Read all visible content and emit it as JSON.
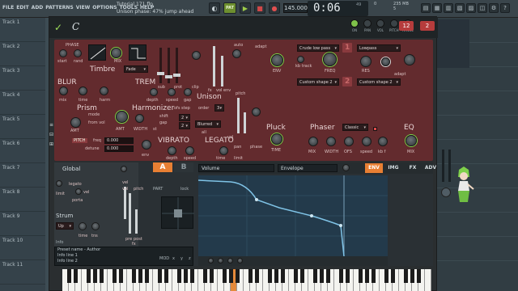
{
  "menu": [
    "FILE",
    "EDIT",
    "ADD",
    "PATTERNS",
    "VIEW",
    "OPTIONS",
    "TOOLS",
    "HELP"
  ],
  "song_title": "Tutorial 171.flp",
  "hint": "Unison phase: 47% jump ahead",
  "transport": {
    "pat_label": "PAT",
    "play": "▶",
    "stop": "■",
    "rec": "●",
    "tempo": "145.000"
  },
  "time": {
    "value": "0:06",
    "frames": "49",
    "sub": "M:S:CS"
  },
  "cpu": "0",
  "memory": {
    "top": "235 MB",
    "bottom": "5"
  },
  "playlist": {
    "tracks": [
      "Track 1",
      "Track 2",
      "Track 3",
      "Track 4",
      "Track 5",
      "Track 6",
      "Track 7",
      "Track 8",
      "Track 9",
      "Track 10",
      "Track 11"
    ]
  },
  "harmor": {
    "header": {
      "logo": "✓",
      "c_label": "C",
      "minis": [
        "ON",
        "PAN",
        "VOL",
        "PITCH",
        "RANGE"
      ],
      "num1": "12",
      "num2": "2"
    },
    "panel": {
      "phase": "PHASE",
      "start": "start",
      "rand": "rand",
      "mix": "MIX",
      "timbre": "Timbre",
      "fade": "Fade",
      "sub": "sub",
      "prot": "prot",
      "clip": "clip",
      "auto": "auto",
      "fx": "fx",
      "vol_env": "vol env",
      "adapt": "adapt",
      "filter1_type": "Crude low pass",
      "filter2_type": "Lowpass",
      "env": "ENV",
      "kb_track": "kb track",
      "freq": "FREQ",
      "res": "RES",
      "adapt2": "adapt",
      "shape1": "Custom shape 2",
      "shape2": "Custom shape 2",
      "blur": "BLUR",
      "mix2": "mix",
      "time": "time",
      "harm": "harm",
      "trem": "TREM",
      "depth": "depth",
      "speed": "speed",
      "gap": "gap",
      "unison": "Unison",
      "order": "order",
      "order_val": "3",
      "pitch": "pitch",
      "vol": "vol",
      "pan": "pan",
      "phase2": "phase",
      "prism": "Prism",
      "mode": "mode",
      "amt": "AMT",
      "from_vol": "from vol",
      "amt2": "AMT",
      "width": "WIDTH",
      "st": "st",
      "harmonizer": "Harmonizer",
      "ofs_step": "ofs step",
      "shift": "shift",
      "gap2": "gap",
      "blurred": "Blurred",
      "all": "all",
      "pluck": "Pluck",
      "phaser": "Phaser",
      "classic": "Classic",
      "eq": "EQ",
      "pitch_lbl": "PITCH",
      "freq2": "freq",
      "detune": "detune",
      "pitch_val1": "0.000",
      "pitch_val2": "0.000",
      "vibrato": "VIBRATO",
      "legato": "LEGATO",
      "time2": "time",
      "limit": "limit",
      "env2": "env",
      "width2": "WIDTH",
      "ofs": "OFS",
      "speed2": "speed",
      "kbf": "kb f",
      "time3": "TIME",
      "mix3": "MIX",
      "mix4": "MIX",
      "mix_lbl": "MIX",
      "depth2": "depth",
      "speed3": "speed",
      "badge1": "1",
      "badge2": "2",
      "badge_big": "2",
      "lvl_rand": "rand",
      "lvl_harm": "harm"
    },
    "lower": {
      "global": "Global",
      "legato": "legato",
      "limit": "limit",
      "porta": "porta",
      "vel": "vel",
      "strum": "Strum",
      "strum_val": "Up",
      "time": "time",
      "tns": "tns",
      "info_label": "Info",
      "info_lines": [
        "Preset name - Author",
        "Info line 1",
        "Info line 2"
      ],
      "a": "A",
      "b": "B",
      "part": "PART",
      "lock": "lock",
      "vel2": "vel",
      "mod": "MOD",
      "x": "x",
      "y": "y",
      "z": "z",
      "pitch_v": "pitch",
      "vol_v": "vol",
      "pre": "pre",
      "post": "post",
      "fx": "fx",
      "env_target": "Volume",
      "env_type": "Envelope",
      "tabs": [
        "ENV",
        "IMG",
        "FX",
        "ADV"
      ]
    }
  },
  "icons": [
    "harmor-logo-icon",
    "play-icon",
    "stop-icon",
    "record-icon",
    "close-icon",
    "chevron-down-icon",
    "sine-icon",
    "square-icon",
    "character-icon"
  ],
  "colors": {
    "accent": "#e87f33",
    "panel": "#632b2e",
    "green": "#7fc24a"
  }
}
